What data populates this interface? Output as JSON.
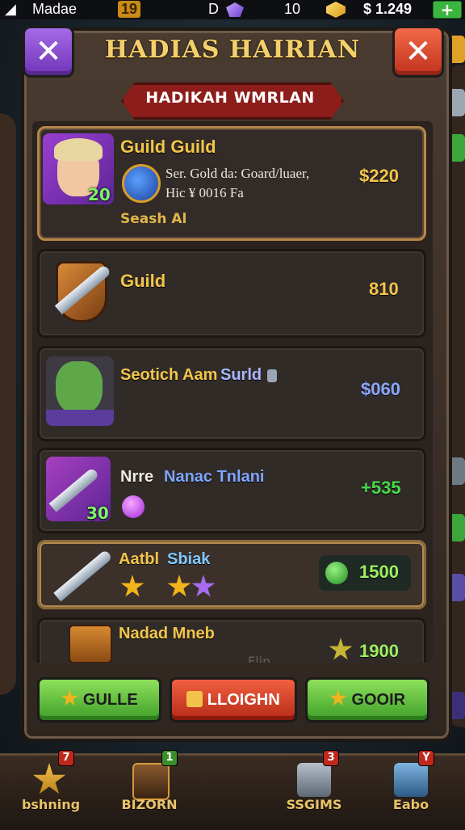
{
  "status_bar": {
    "app_label": "Madae",
    "left_count": "19",
    "gem_count": "10",
    "currency_count": "$ 1.249",
    "plus_label": "+"
  },
  "modal": {
    "title": "HADIAS HAIRIAN",
    "banner": "HADIKAH WMRLAN",
    "close_label": "✕"
  },
  "rows": [
    {
      "name": "Guild Guild",
      "description_line1": "Ser. Gold da: Goard/luaer,",
      "description_line2": "Hic ¥ 0016 Fa",
      "footer": "Seash Al",
      "level": "20",
      "price": "$220",
      "price_color": "#f3c64a"
    },
    {
      "name": "Guild",
      "price": "810",
      "price_color": "#f3c64a"
    },
    {
      "name_part1": "Seotich Aam",
      "name_part2": "Surld",
      "price": "$060",
      "price_color": "#8aa6ff"
    },
    {
      "name_part1": "Nrre",
      "name_part2": "Nanac Tnlani",
      "level": "30",
      "price": "+535",
      "price_color": "#48d94a"
    },
    {
      "name_part1": "Aatbl",
      "name_part2": "Sbiak",
      "stars": 3,
      "price": "1500",
      "price_color": "#9cf062"
    },
    {
      "name": "Nadad Mneb",
      "sub": "Flin",
      "price": "1900",
      "price_color": "#9cf062"
    }
  ],
  "footer_buttons": {
    "left": "GULLE",
    "middle": "LLOIGHN",
    "right": "GOOIR"
  },
  "bottom_nav": [
    {
      "label": "bshning",
      "badge": "7",
      "badge_color": "#c0281c"
    },
    {
      "label": "BIZORN",
      "badge": "1",
      "badge_color": "#3b8f2a"
    },
    {
      "label": "SSGIMS",
      "badge": "3",
      "badge_color": "#c0281c"
    },
    {
      "label": "Eabo",
      "badge": "Y",
      "badge_color": "#c0281c"
    }
  ],
  "colors": {
    "gold_text": "#f3c64a",
    "close_purple": "#8a4bd1",
    "close_red": "#d8432a",
    "banner_red": "#8c1d1a"
  }
}
